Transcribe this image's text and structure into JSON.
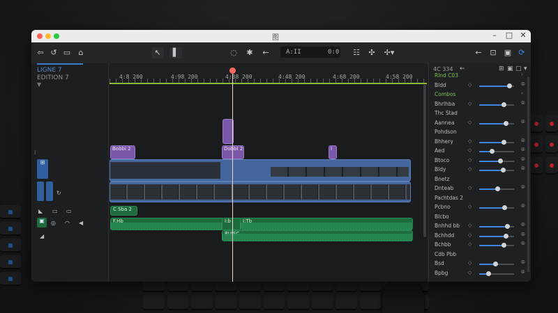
{
  "window": {
    "title": "图"
  },
  "toolbar": {
    "timecode_left": "A:II",
    "timecode_right": "0:0"
  },
  "project": {
    "name": "LIGNE 7",
    "edition": "EDITION 7"
  },
  "ruler": {
    "ticks": [
      "4:8 200",
      "4:98 200",
      "4:88 200",
      "4:48 200",
      "4:68 200",
      "4:58 200"
    ]
  },
  "tracks": {
    "title_clips": [
      "Bobbi 2",
      "DobbI 2",
      "I"
    ],
    "audio_clips": [
      "C Sba 2",
      "F.Hb",
      "I:b",
      "I:Tb",
      "BUISC"
    ]
  },
  "inspector": {
    "header": "4C 334",
    "rows": [
      {
        "label": "Rlnd C03",
        "kind": "section"
      },
      {
        "label": "Bldd",
        "kind": "slider",
        "value": 0.85
      },
      {
        "label": "Combos",
        "kind": "section"
      },
      {
        "label": "Bhrlhba",
        "kind": "slider",
        "value": 0.7
      },
      {
        "label": "Thc Stad",
        "kind": "text"
      },
      {
        "label": "Aannea",
        "kind": "slider",
        "value": 0.75
      },
      {
        "label": "Pohdson",
        "kind": "text"
      },
      {
        "label": "Bhhery",
        "kind": "slider",
        "value": 0.7
      },
      {
        "label": "Aed",
        "kind": "slider",
        "value": 0.35
      },
      {
        "label": "Btoco",
        "kind": "slider",
        "value": 0.6
      },
      {
        "label": "Bldy",
        "kind": "slider",
        "value": 0.68
      },
      {
        "label": "Bnetz",
        "kind": "text"
      },
      {
        "label": "Dnteab",
        "kind": "slider",
        "value": 0.52
      },
      {
        "label": "Pachtdas 2",
        "kind": "text"
      },
      {
        "label": "Pcbno",
        "kind": "slider",
        "value": 0.72
      },
      {
        "label": "Blcbo",
        "kind": "text"
      },
      {
        "label": "Bnhhd bb",
        "kind": "slider",
        "value": 0.8
      },
      {
        "label": "Bchhdd",
        "kind": "slider",
        "value": 0.75
      },
      {
        "label": "Bchbb",
        "kind": "slider",
        "value": 0.7
      },
      {
        "label": "Cdb Pbb",
        "kind": "text"
      },
      {
        "label": "Bsd",
        "kind": "slider",
        "value": 0.45
      },
      {
        "label": "Bpbg",
        "kind": "slider",
        "value": 0.25
      }
    ]
  },
  "colors": {
    "accent_blue": "#3b86e0",
    "video_clip": "#44669c",
    "title_clip": "#7a57a8",
    "audio_clip": "#1e6b3d",
    "playhead": "#ff6a5c",
    "ruler_line": "#8dbb2f"
  }
}
